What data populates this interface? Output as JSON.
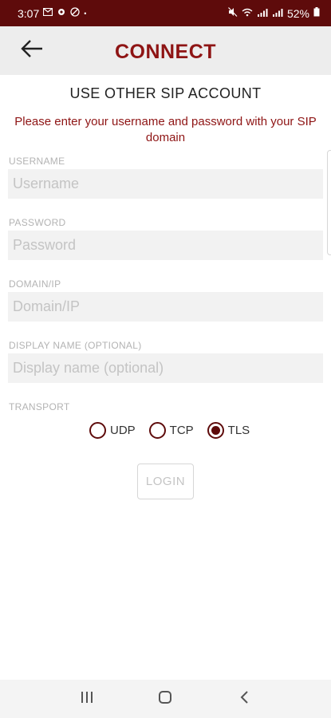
{
  "status_bar": {
    "time": "3:07",
    "dot": "•",
    "battery": "52%",
    "left_icons": [
      "mail-icon",
      "settings-icon",
      "blocked-icon"
    ],
    "right_icons": [
      "mute-icon",
      "wifi-icon",
      "signal-icon",
      "signal-icon",
      "battery-icon"
    ]
  },
  "toolbar": {
    "title": "CONNECT",
    "back_icon": "arrow-left-icon"
  },
  "section": {
    "title": "USE OTHER SIP ACCOUNT",
    "instructions_line1": "Please enter your username and password with your SIP",
    "instructions_line2": "domain"
  },
  "form": {
    "username": {
      "label": "USERNAME",
      "placeholder": "Username",
      "value": ""
    },
    "password": {
      "label": "PASSWORD",
      "placeholder": "Password",
      "value": ""
    },
    "domain": {
      "label": "DOMAIN/IP",
      "placeholder": "Domain/IP",
      "value": ""
    },
    "display_name": {
      "label": "DISPLAY NAME (OPTIONAL)",
      "placeholder": "Display name (optional)",
      "value": ""
    },
    "transport": {
      "label": "TRANSPORT",
      "options": [
        {
          "label": "UDP",
          "checked": false
        },
        {
          "label": "TCP",
          "checked": false
        },
        {
          "label": "TLS",
          "checked": true
        }
      ]
    },
    "login_label": "LOGIN"
  },
  "colors": {
    "accent": "#8e1414",
    "status_bar": "#5e0b0b",
    "toolbar_bg": "#ededed",
    "input_bg": "#f2f2f2"
  },
  "nav_bar": {
    "icons": [
      "recent-apps-icon",
      "home-icon",
      "back-icon"
    ]
  }
}
